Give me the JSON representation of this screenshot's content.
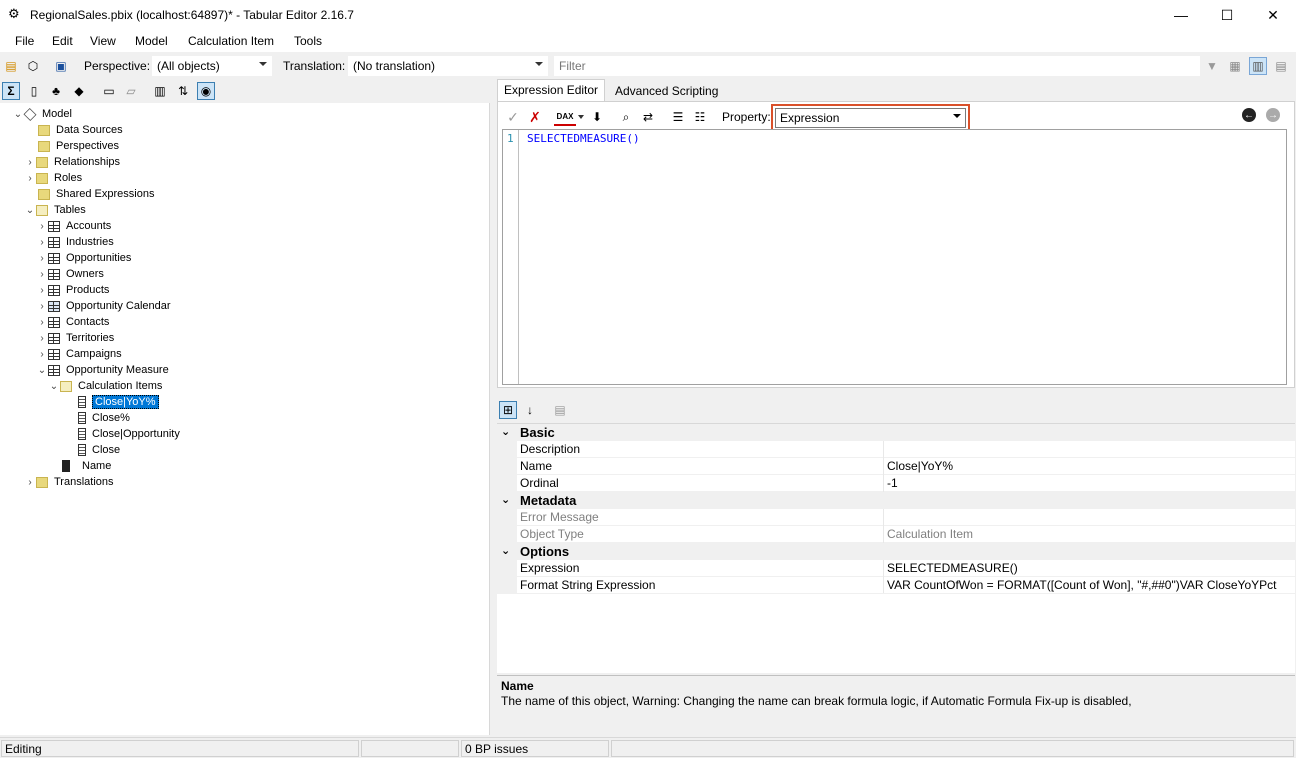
{
  "window": {
    "title": "RegionalSales.pbix (localhost:64897)* - Tabular Editor 2.16.7",
    "minimize": "—",
    "maximize": "☐",
    "close": "✕"
  },
  "menu": [
    "File",
    "Edit",
    "View",
    "Model",
    "Calculation Item",
    "Tools"
  ],
  "toolbar": {
    "perspective_label": "Perspective:",
    "perspective_value": "(All objects)",
    "translation_label": "Translation:",
    "translation_value": "(No translation)",
    "filter_placeholder": "Filter"
  },
  "tree": {
    "root": "Model",
    "items": [
      "Data Sources",
      "Perspectives",
      "Relationships",
      "Roles",
      "Shared Expressions",
      "Tables"
    ],
    "tables": [
      "Accounts",
      "Industries",
      "Opportunities",
      "Owners",
      "Products",
      "Opportunity Calendar",
      "Contacts",
      "Territories",
      "Campaigns",
      "Opportunity Measure"
    ],
    "calc_group": "Calculation Items",
    "calc_items": [
      "Close|YoY%",
      "Close%",
      "Close|Opportunity",
      "Close"
    ],
    "name_col": "Name",
    "translations": "Translations"
  },
  "editor": {
    "tab_expression": "Expression Editor",
    "tab_scripting": "Advanced Scripting",
    "property_label": "Property:",
    "property_value": "Expression",
    "dax_label": "DAX",
    "line_number": "1",
    "code": "SELECTEDMEASURE()"
  },
  "properties": {
    "cat_basic": "Basic",
    "description": "Description",
    "name_label": "Name",
    "name_value": "Close|YoY%",
    "ordinal_label": "Ordinal",
    "ordinal_value": "-1",
    "cat_metadata": "Metadata",
    "error_label": "Error Message",
    "objtype_label": "Object Type",
    "objtype_value": "Calculation Item",
    "cat_options": "Options",
    "expr_label": "Expression",
    "expr_value": "SELECTEDMEASURE()",
    "fmt_label": "Format String Expression",
    "fmt_value": "VAR CountOfWon = FORMAT([Count of Won], \"#,##0\")VAR CloseYoYPct"
  },
  "help": {
    "title": "Name",
    "text": "The name of this object, Warning: Changing the name can break formula logic, if Automatic Formula Fix-up is disabled,"
  },
  "status": {
    "mode": "Editing",
    "issues": "0 BP issues"
  }
}
